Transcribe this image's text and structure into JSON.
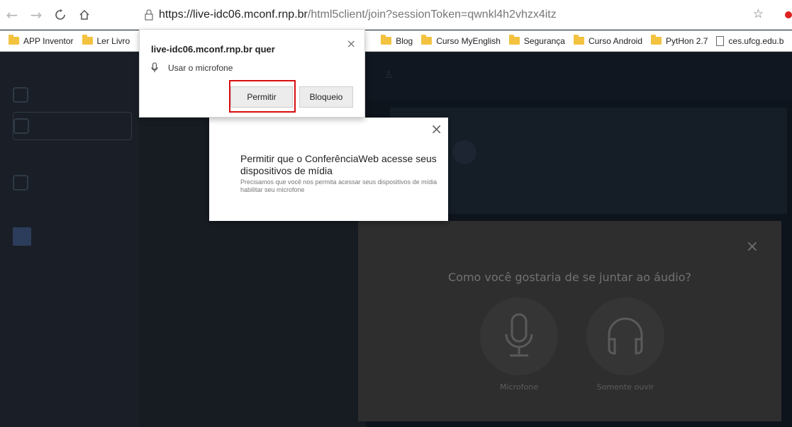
{
  "browser": {
    "url_host": "https://live-idc06.mconf.rnp.br",
    "url_path": "/html5client/join?sessionToken=qwnkl4h2vhzx4itz",
    "bookmarks": [
      {
        "label": "APP Inventor",
        "type": "folder"
      },
      {
        "label": "Ler Livro",
        "type": "folder"
      },
      {
        "label": "Blog",
        "type": "folder"
      },
      {
        "label": "Curso MyEnglish",
        "type": "folder"
      },
      {
        "label": "Segurança",
        "type": "folder"
      },
      {
        "label": "Curso Android",
        "type": "folder"
      },
      {
        "label": "PytHon 2.7",
        "type": "folder"
      },
      {
        "label": "ces.ufcg.edu.b",
        "type": "page"
      }
    ]
  },
  "permission_popup": {
    "title": "live-idc06.mconf.rnp.br quer",
    "request": "Usar o microfone",
    "allow_label": "Permitir",
    "block_label": "Bloqueio",
    "close_glyph": "×"
  },
  "media_dialog": {
    "title": "Permitir que o ConferênciaWeb acesse seus dispositivos de mídia",
    "description": "Precisamos que você nos permita acessar seus dispositivos de mídia habilitar seu microfone",
    "close_glyph": "×"
  },
  "audio_modal": {
    "title": "Como você gostaria de se juntar ao áudio?",
    "close_glyph": "×",
    "options": [
      {
        "label": "Microfone",
        "icon": "microphone-icon"
      },
      {
        "label": "Somente ouvir",
        "icon": "headphones-icon"
      }
    ]
  },
  "colors": {
    "accent_red": "#d90e0e",
    "folder": "#f3c23f"
  }
}
